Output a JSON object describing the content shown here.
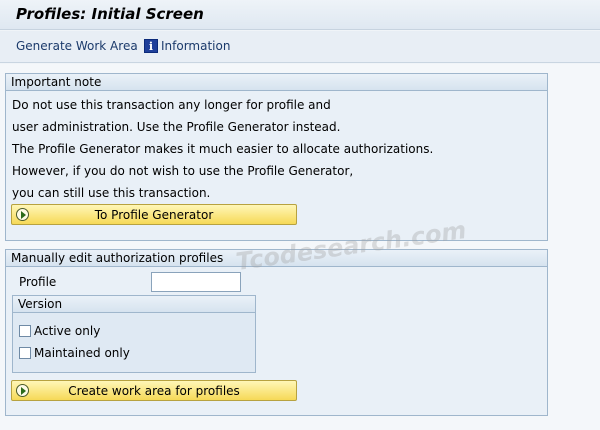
{
  "window": {
    "title": "Profiles: Initial Screen"
  },
  "toolbar": {
    "generate_work_area": "Generate Work Area",
    "information": "Information",
    "information_icon": "info-icon"
  },
  "important_note": {
    "header": "Important note",
    "lines": [
      "Do not use this transaction any longer for profile and",
      "user administration. Use the Profile Generator instead.",
      "The Profile Generator makes it much easier to allocate authorizations.",
      "However, if you do not wish to use the Profile Generator,",
      "you can still use this transaction."
    ],
    "button": "To Profile Generator"
  },
  "manual_edit": {
    "header": "Manually edit authorization profiles",
    "profile_label": "Profile",
    "profile_value": "",
    "version": {
      "header": "Version",
      "options": [
        {
          "label": "Active only",
          "checked": false
        },
        {
          "label": "Maintained only",
          "checked": false
        }
      ]
    },
    "button": "Create work area for profiles"
  },
  "watermark": "Tcodesearch.com",
  "colors": {
    "button_bg": "#f6d957",
    "group_bg": "#e9f0f7",
    "link": "#1b3a6b"
  }
}
